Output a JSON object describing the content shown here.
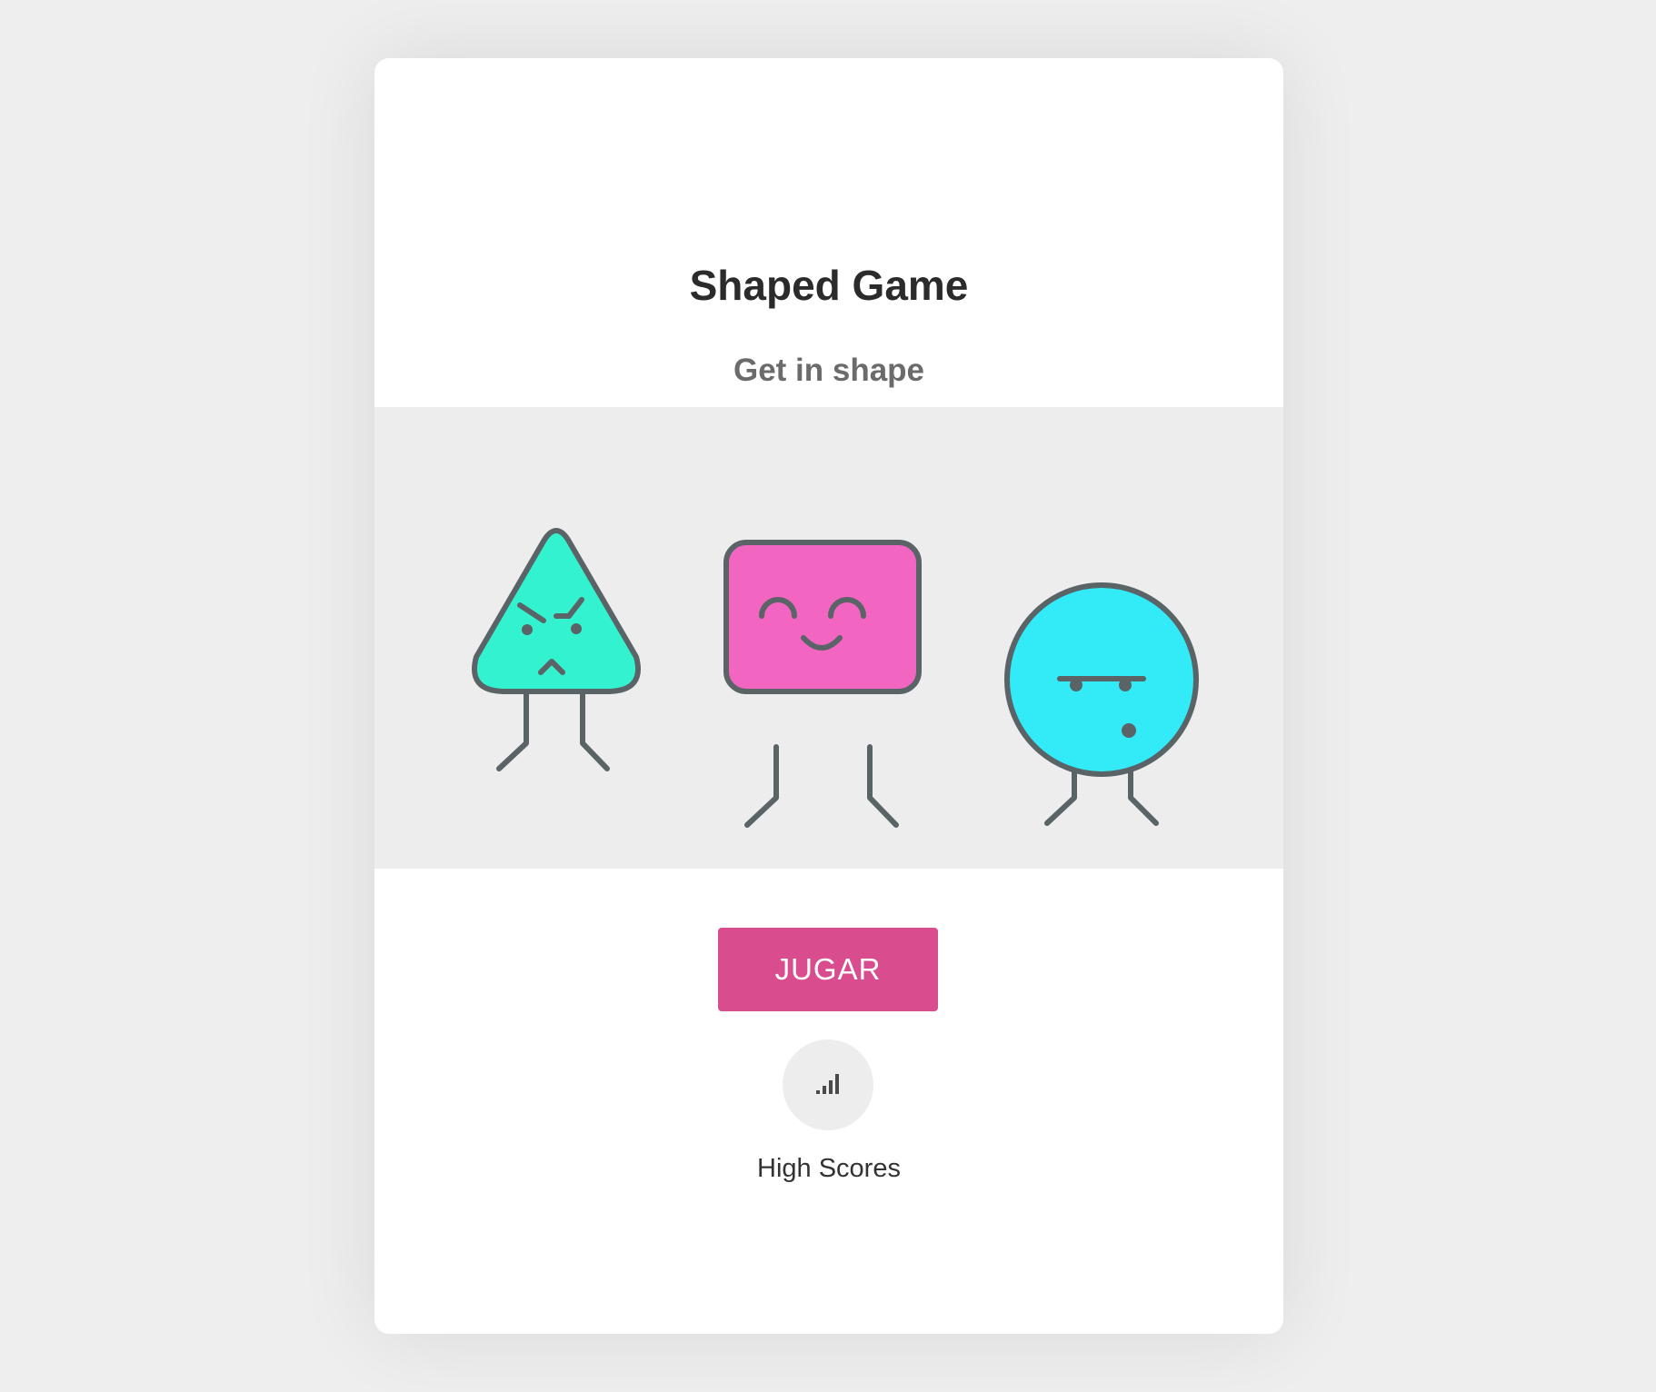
{
  "app": {
    "title": "Shaped Game",
    "subtitle": "Get in shape"
  },
  "characters": [
    {
      "shape": "triangle",
      "expression": "angry",
      "color": "#33f2d0"
    },
    {
      "shape": "rounded-square",
      "expression": "happy",
      "color": "#f266c2"
    },
    {
      "shape": "circle",
      "expression": "skeptical",
      "color": "#33eaf7"
    }
  ],
  "actions": {
    "play_label": "JUGAR",
    "high_scores_icon": "bar-chart-icon",
    "high_scores_label": "High Scores"
  },
  "colors": {
    "background": "#eeeeee",
    "card": "#ffffff",
    "banner": "#ededed",
    "accent": "#d94d8f",
    "outline": "#5a6366"
  }
}
